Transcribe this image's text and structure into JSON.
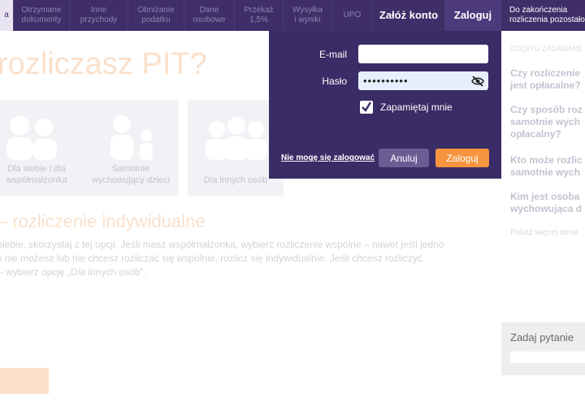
{
  "nav": {
    "items": [
      {
        "label": "a"
      },
      {
        "label": "Otrzymane\ndokumenty"
      },
      {
        "label": "Inne\nprzychody"
      },
      {
        "label": "Obniżanie\npodatku"
      },
      {
        "label": "Dane\nosobowe"
      },
      {
        "label": "Przekaż\n1,5%"
      },
      {
        "label": "Wysyłka\ni wyniki"
      },
      {
        "label": "UPO"
      }
    ],
    "create_account": "Załóż konto",
    "login": "Zaloguj",
    "deadline_text": "Do zakończenia\nrozliczenia pozostało"
  },
  "background": {
    "heading": "rozliczasz PIT?",
    "cards": [
      {
        "label": "Dla siebie i dla\nwspółmałżonka"
      },
      {
        "label": "Samotnie\nwychowujący dzieci"
      },
      {
        "label": "Dla innych osób"
      }
    ],
    "subhead": "– rozliczenie indywidualne",
    "paragraph_lines": [
      "siebie, skorzystaj z tej opcji. Jeśli masz współmałżonka, wybierz rozliczenie wspólne – nawet jeśli jedno",
      "li nie możesz lub nie chcesz rozliczać się wspólnie, rozlicz się indywidualnie. Jeśli chcesz rozliczyć",
      "– wybierz opcję „Dla innych osób”."
    ]
  },
  "sidebar": {
    "title": "CZĘSTO ZADAWANE PY",
    "questions": [
      "Czy rozliczenie\njest opłacalne?",
      "Czy sposób roz\nsamotnie wych\nopłacalny?",
      "Kto może rozlic\nsamotnie wych",
      "Kim jest osoba\nwychowująca d"
    ],
    "more": "Pokaż więcej tema",
    "ask": "Zadaj pytanie"
  },
  "login_panel": {
    "email_label": "E-mail",
    "email_value": "",
    "password_label": "Hasło",
    "password_value": "••••••••••",
    "remember_label": "Zapamiętaj mnie",
    "remember_checked": true,
    "forgot_link": "Nie mogę się zalogować",
    "cancel_button": "Anuluj",
    "login_button": "Zaloguj"
  }
}
